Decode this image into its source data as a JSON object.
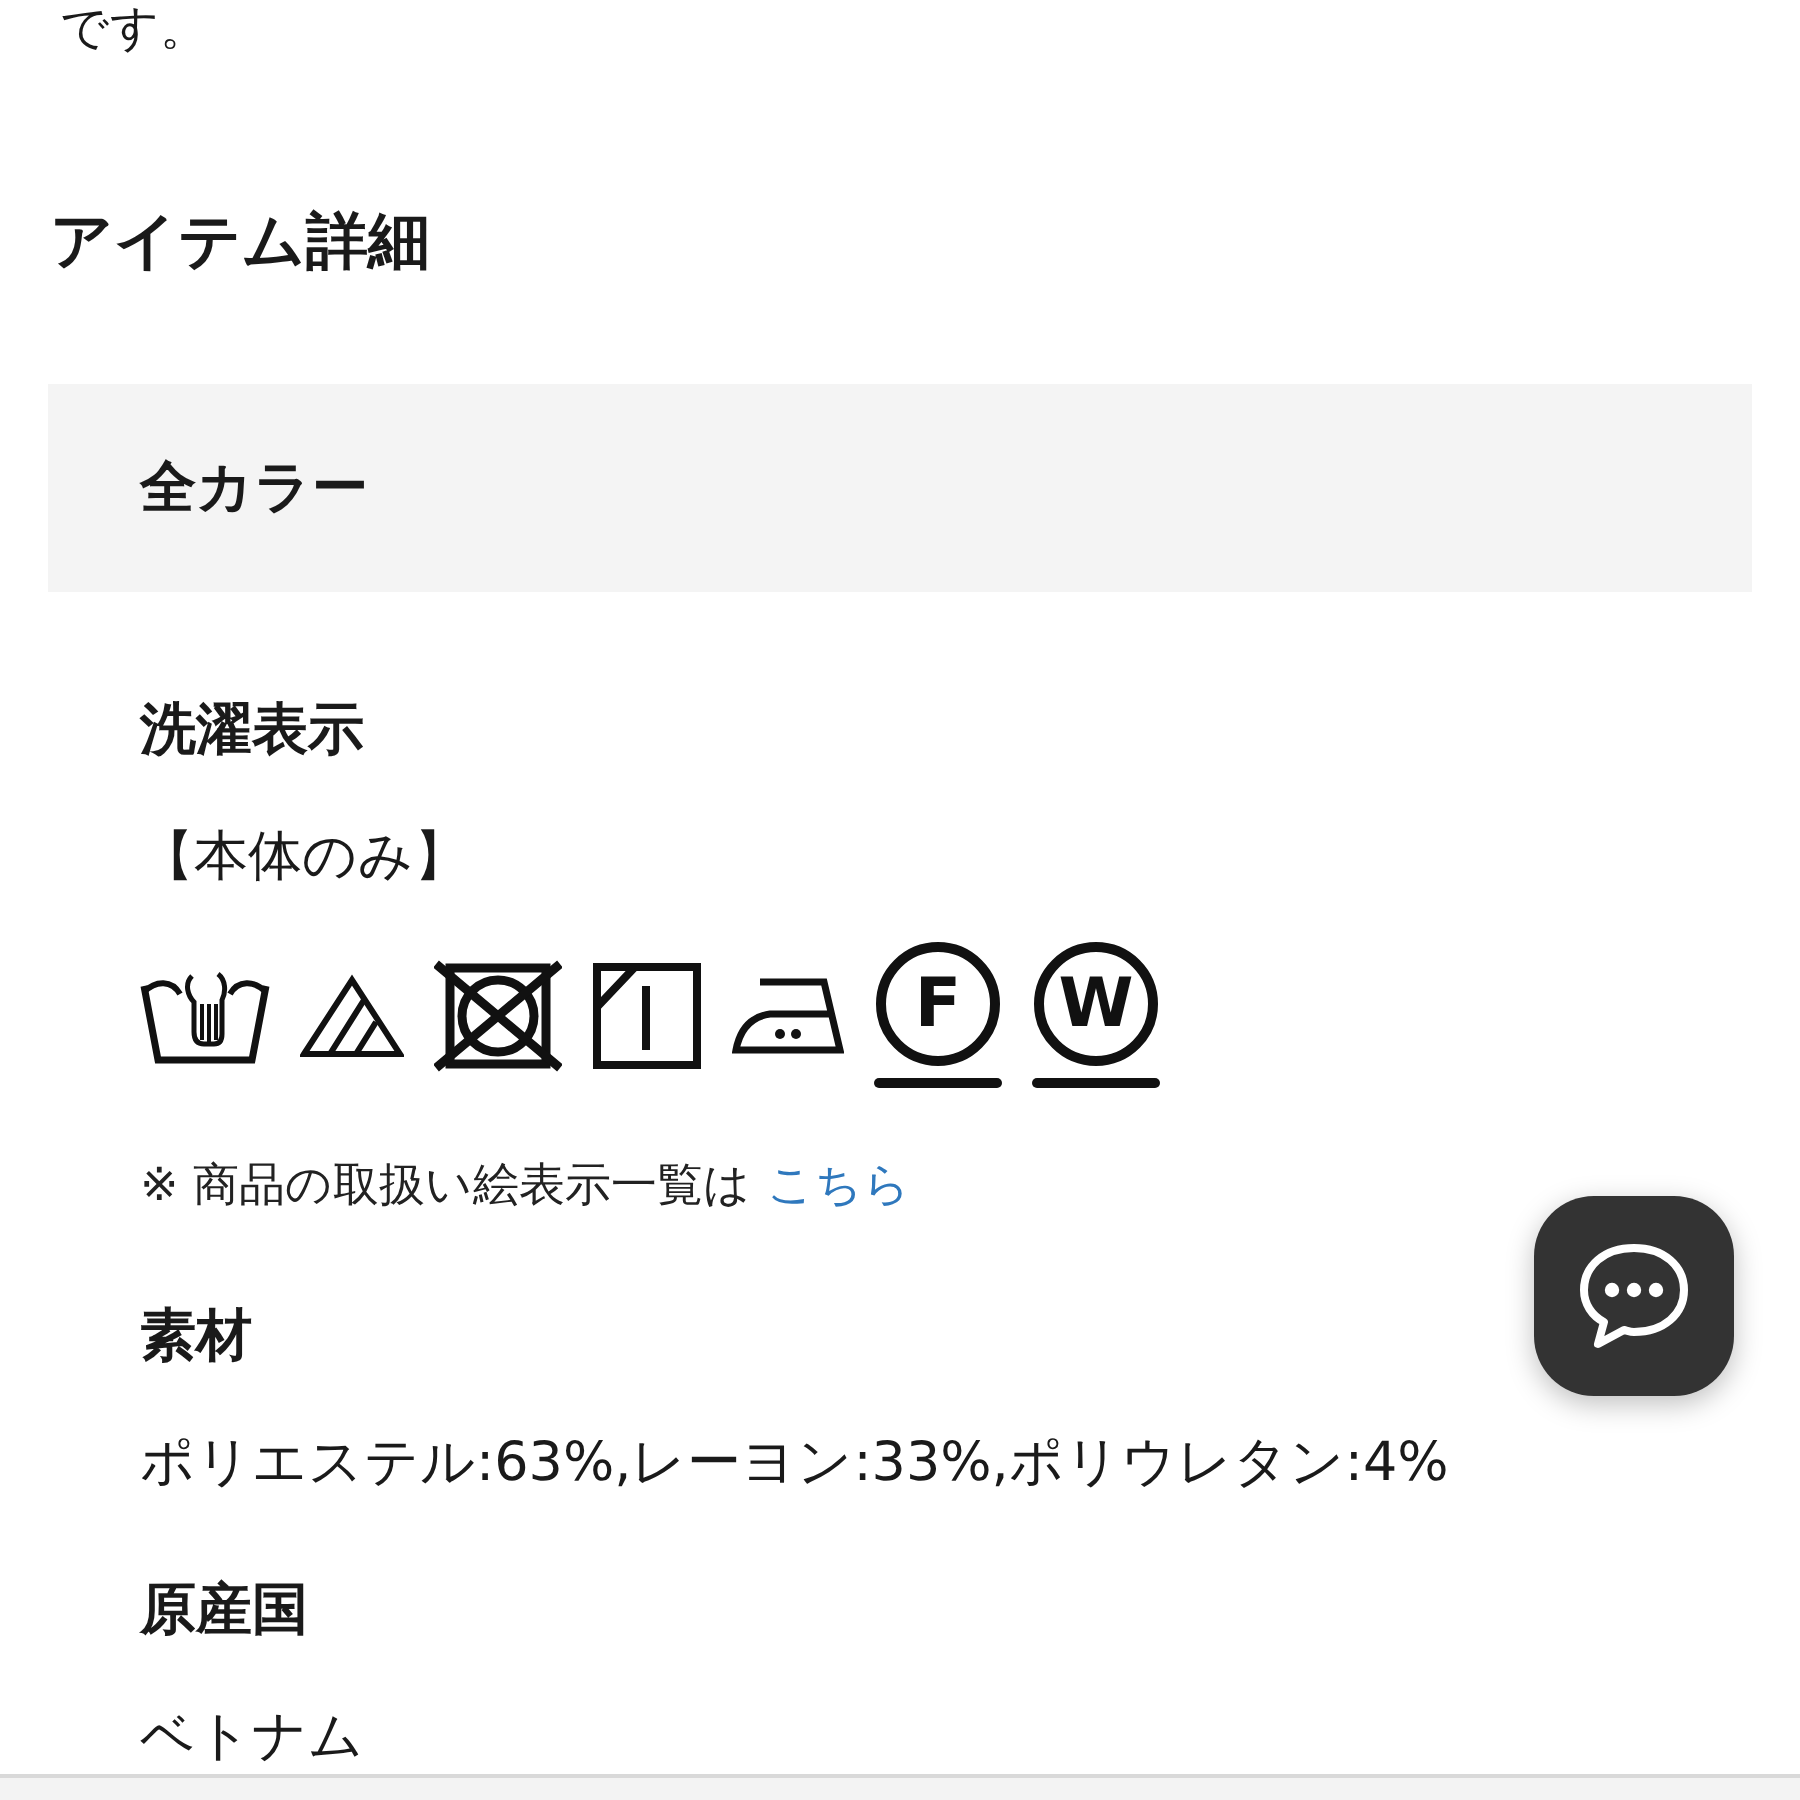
{
  "intro_tail": "です。",
  "section_title": "アイテム詳細",
  "color_bar": {
    "label": "全カラー"
  },
  "care": {
    "heading": "洗濯表示",
    "scope": "【本体のみ】",
    "symbols": [
      {
        "kind": "hand-wash"
      },
      {
        "kind": "bleach"
      },
      {
        "kind": "no-tumble-dry"
      },
      {
        "kind": "shade-line-dry"
      },
      {
        "kind": "iron"
      },
      {
        "kind": "circled-letter",
        "letter": "F"
      },
      {
        "kind": "circled-letter",
        "letter": "W"
      }
    ],
    "note": {
      "text": "※ 商品の取扱い絵表示一覧は",
      "link": "こちら"
    }
  },
  "fields": [
    {
      "label": "素材",
      "value": "ポリエステル:63%,レーヨン:33%,ポリウレタン:4%"
    },
    {
      "label": "原産国",
      "value": "ベトナム"
    }
  ]
}
